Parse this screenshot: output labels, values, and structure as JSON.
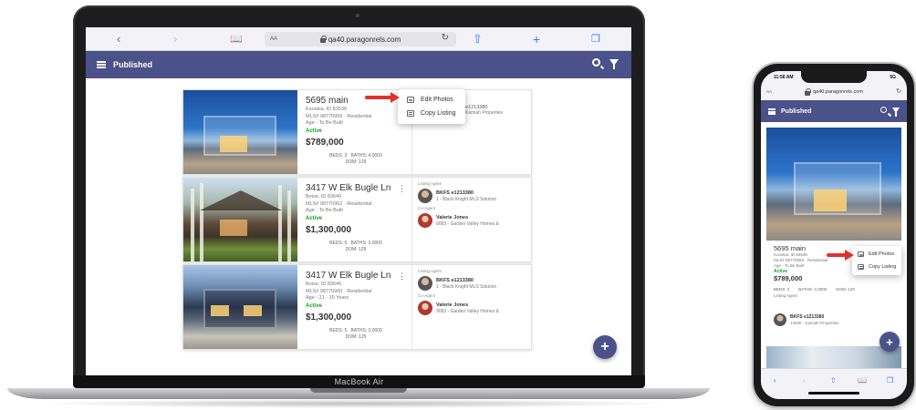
{
  "browser": {
    "url": "qa40.paragonrels.com",
    "aa_label": "AA",
    "back_icon": "chevron-left-icon",
    "forward_icon": "chevron-right-icon",
    "book_icon": "book-icon",
    "reload_icon": "reload-icon",
    "share_icon": "share-icon",
    "new_tab_icon": "plus-icon",
    "tabs_icon": "tabs-icon"
  },
  "header": {
    "title": "Published",
    "search_icon": "search-icon",
    "filter_icon": "filter-icon"
  },
  "laptop_label": "MacBook Air",
  "listings": [
    {
      "address": "5695 main",
      "city": "Kooskia, ID 83539",
      "mls": "MLS# 98770959 · Residential",
      "age": "Age - To Be Built",
      "status": "Active",
      "price": "$789,000",
      "beds": "BEDS: 3",
      "baths": "BATHS: 4.0000",
      "dom": "DOM: 129",
      "agents_partial": "e1213380",
      "agents_partial_org": "Kamiah Properties"
    },
    {
      "address": "3417 W Elk Bugle Ln",
      "city": "Boise, ID 83646",
      "mls": "MLS# 98770962 · Residential",
      "age": "Age - To Be Built",
      "status": "Active",
      "price": "$1,300,000",
      "beds": "BEDS: 5",
      "baths": "BATHS: 3.0000",
      "dom": "DOM: 129",
      "listing_agent_caption": "Listing Agent",
      "listing_agent_name": "BKFS e1213380",
      "listing_agent_org": "1 - Black Knight MLS Solution",
      "co_agent_caption": "Co-Agent",
      "co_agent_name": "Valerie Jones",
      "co_agent_org": "9083 - Garden Valley Homes &"
    },
    {
      "address": "3417 W Elk Bugle Ln",
      "city": "Boise, ID 83646",
      "mls": "MLS# 98770960 · Residential",
      "age": "Age - 21 - 30 Years",
      "status": "Active",
      "price": "$1,300,000",
      "beds": "BEDS: 5",
      "baths": "BATHS: 3.0000",
      "dom": "DOM: 129",
      "listing_agent_caption": "Listing Agent",
      "listing_agent_name": "BKFS e1213380",
      "listing_agent_org": "1 - Black Knight MLS Solution",
      "co_agent_caption": "Co-Agent",
      "co_agent_name": "Valerie Jones",
      "co_agent_org": "9083 - Garden Valley Homes &"
    }
  ],
  "popup_menu": {
    "edit_photos": "Edit Photos",
    "copy_listing": "Copy Listing"
  },
  "fab": {
    "label": "+"
  },
  "phone": {
    "time": "11:56 AM",
    "signal": "5G",
    "url": "qa40.paragonrels.com",
    "aa_label": "AA",
    "title": "Published",
    "address": "5695 main",
    "city": "Kooskia, ID 83539",
    "mls": "MLS# 98770959 · Residential",
    "age": "Age - To Be Built",
    "status": "Active",
    "price": "$789,000",
    "beds": "BEDS: 3",
    "baths": "BATHS: 4.0000",
    "dom": "DOM: 129",
    "listing_agent_caption": "Listing Agent",
    "agent_name": "BKFS e1213380",
    "agent_org": "12590 - Kamiah Properties",
    "edit_photos": "Edit Photos",
    "copy_listing": "Copy Listing"
  },
  "colors": {
    "header": "#4b5289",
    "status_active": "#16a02a",
    "arrow": "#e0322c",
    "link": "#2f7cf6"
  }
}
